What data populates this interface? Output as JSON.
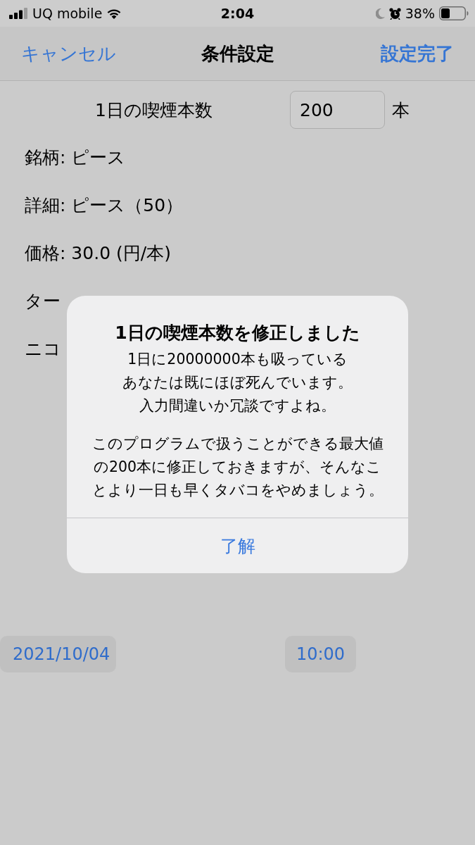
{
  "status_bar": {
    "carrier": "UQ mobile",
    "time": "2:04",
    "battery": "38%"
  },
  "nav_bar": {
    "cancel": "キャンセル",
    "title": "条件設定",
    "done": "設定完了"
  },
  "form": {
    "daily_count": {
      "label": "1日の喫煙本数",
      "value": "200",
      "unit": "本"
    },
    "fields": [
      "銘柄: ピース",
      "詳細: ピース（50）",
      "価格: 30.0 (円/本)",
      "ター",
      "ニコ"
    ],
    "date_button": "2021/10/04",
    "time_button": "10:00"
  },
  "alert": {
    "title": "1日の喫煙本数を修正しました",
    "message": [
      [
        "1日に20000000本も吸っている",
        "あなたは既にほぼ死んでいます。",
        "入力間違いか冗談ですよね。"
      ],
      [
        "このプログラムで扱うことができる最大値",
        "の200本に修正しておきますが、そんなこ",
        "とより一日も早くタバコをやめましょう。"
      ]
    ],
    "button": "了解"
  }
}
